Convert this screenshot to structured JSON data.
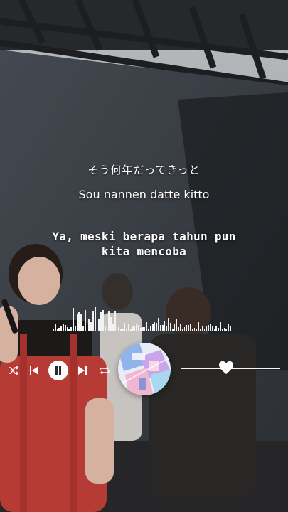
{
  "lyrics": {
    "japanese": "そう何年だってきっと",
    "romaji": "Sou nannen datte kitto",
    "translation_line1": "Ya, meski berapa tahun pun",
    "translation_line2": "kita mencoba"
  },
  "player": {
    "shuffle_icon": "shuffle-icon",
    "previous_icon": "skip-previous-icon",
    "pause_icon": "pause-icon",
    "next_icon": "skip-next-icon",
    "repeat_icon": "repeat-icon",
    "progress_thumb_icon": "heart-icon",
    "progress_fraction": 0.46
  },
  "colors": {
    "text": "#ffffff",
    "accent": "#ffffff"
  }
}
